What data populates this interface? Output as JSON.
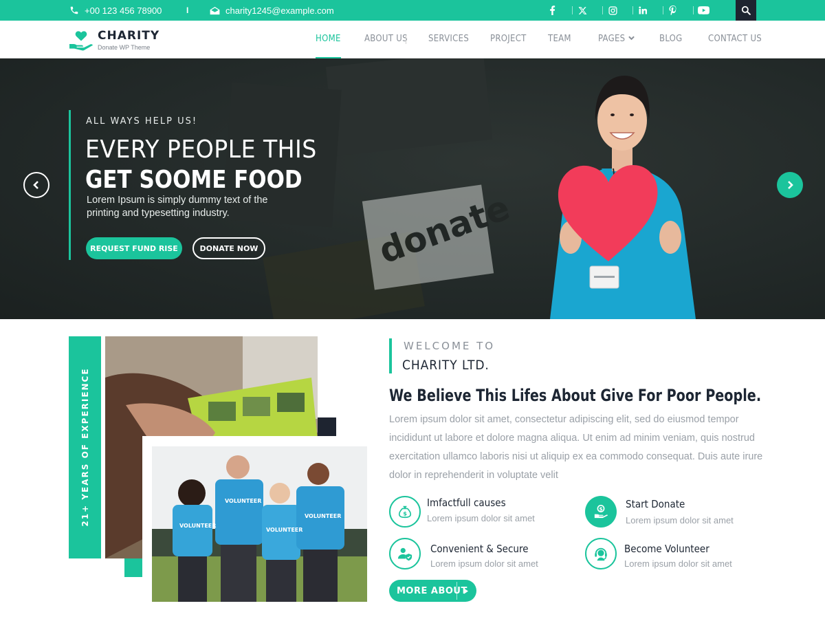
{
  "topbar": {
    "phone": "+00 123 456 78900",
    "separator": "I",
    "email": "charity1245@example.com",
    "social_icons": [
      "facebook-icon",
      "x-twitter-icon",
      "instagram-icon",
      "linkedin-icon",
      "pinterest-icon",
      "youtube-icon"
    ],
    "search_icon": "search-icon"
  },
  "logo": {
    "title": "CHARITY",
    "subtitle": "Donate WP Theme"
  },
  "nav": {
    "items": [
      "HOME",
      "ABOUT US",
      "SERVICES",
      "PROJECT",
      "TEAM",
      "PAGES",
      "BLOG",
      "CONTACT US"
    ],
    "active": "HOME"
  },
  "hero": {
    "kicker": "ALL WAYS HELP US!",
    "line1": "EVERY PEOPLE THIS",
    "line2": "GET SOOME FOOD",
    "text": "Lorem Ipsum is simply dummy text of the printing and typesetting industry.",
    "btn_primary": "REQUEST FUND RISE",
    "btn_secondary": "DONATE NOW",
    "sign_text": "donate"
  },
  "about": {
    "experience": "21+ YEARS OF EXPERIENCE",
    "kicker": "WELCOME TO",
    "title": "CHARITY LTD.",
    "heading": "We Believe This Lifes About Give For Poor People.",
    "text": "Lorem ipsum dolor sit amet, consectetur adipiscing elit, sed do eiusmod tempor incididunt ut labore et dolore magna aliqua. Ut enim ad minim veniam, quis nostrud exercitation ullamco laboris nisi ut aliquip ex ea commodo consequat. Duis aute irure dolor in reprehenderit in voluptate velit",
    "features": [
      {
        "title": "Imfactfull causes",
        "desc": "Lorem ipsum dolor sit amet",
        "icon": "money-bag-icon"
      },
      {
        "title": "Start Donate",
        "desc": "Lorem ipsum dolor sit amet",
        "icon": "donate-hand-icon"
      },
      {
        "title": "Convenient & Secure",
        "desc": "Lorem ipsum dolor sit amet",
        "icon": "secure-user-icon"
      },
      {
        "title": "Become Volunteer",
        "desc": "Lorem ipsum dolor sit amet",
        "icon": "volunteer-headset-icon"
      }
    ],
    "button": "MORE ABOUT",
    "photo_shirt_text": "VOLUNTEER"
  },
  "colors": {
    "accent": "#1bc49c",
    "dark": "#1e2430",
    "text_muted": "#9aa0a7"
  }
}
